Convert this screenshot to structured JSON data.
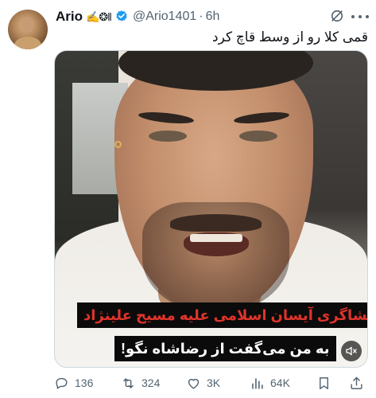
{
  "author": {
    "display_name": "Ario",
    "name_emoji": "✍️❂‖",
    "handle": "@Ario1401",
    "separator": "·",
    "time": "6h"
  },
  "tweet": {
    "text": "قمی کلا رو از وسط قاچ کرد"
  },
  "media": {
    "caption_headline": "افشاگری آیسان اسلامی علیه مسیح علینژاد",
    "caption_quote": "به من می‌گفت از رضاشاه نگو!",
    "caption_headline_color": "#e0342b"
  },
  "actions": {
    "replies": "136",
    "reposts": "324",
    "likes": "3K",
    "views": "64K"
  },
  "colors": {
    "text": "#0f1419",
    "secondary": "#536471",
    "verified": "#1d9bf0"
  },
  "icons": [
    "verified-badge-icon",
    "grok-icon",
    "more-icon",
    "mute-icon",
    "reply-icon",
    "repost-icon",
    "like-icon",
    "views-icon",
    "bookmark-icon",
    "share-icon"
  ]
}
